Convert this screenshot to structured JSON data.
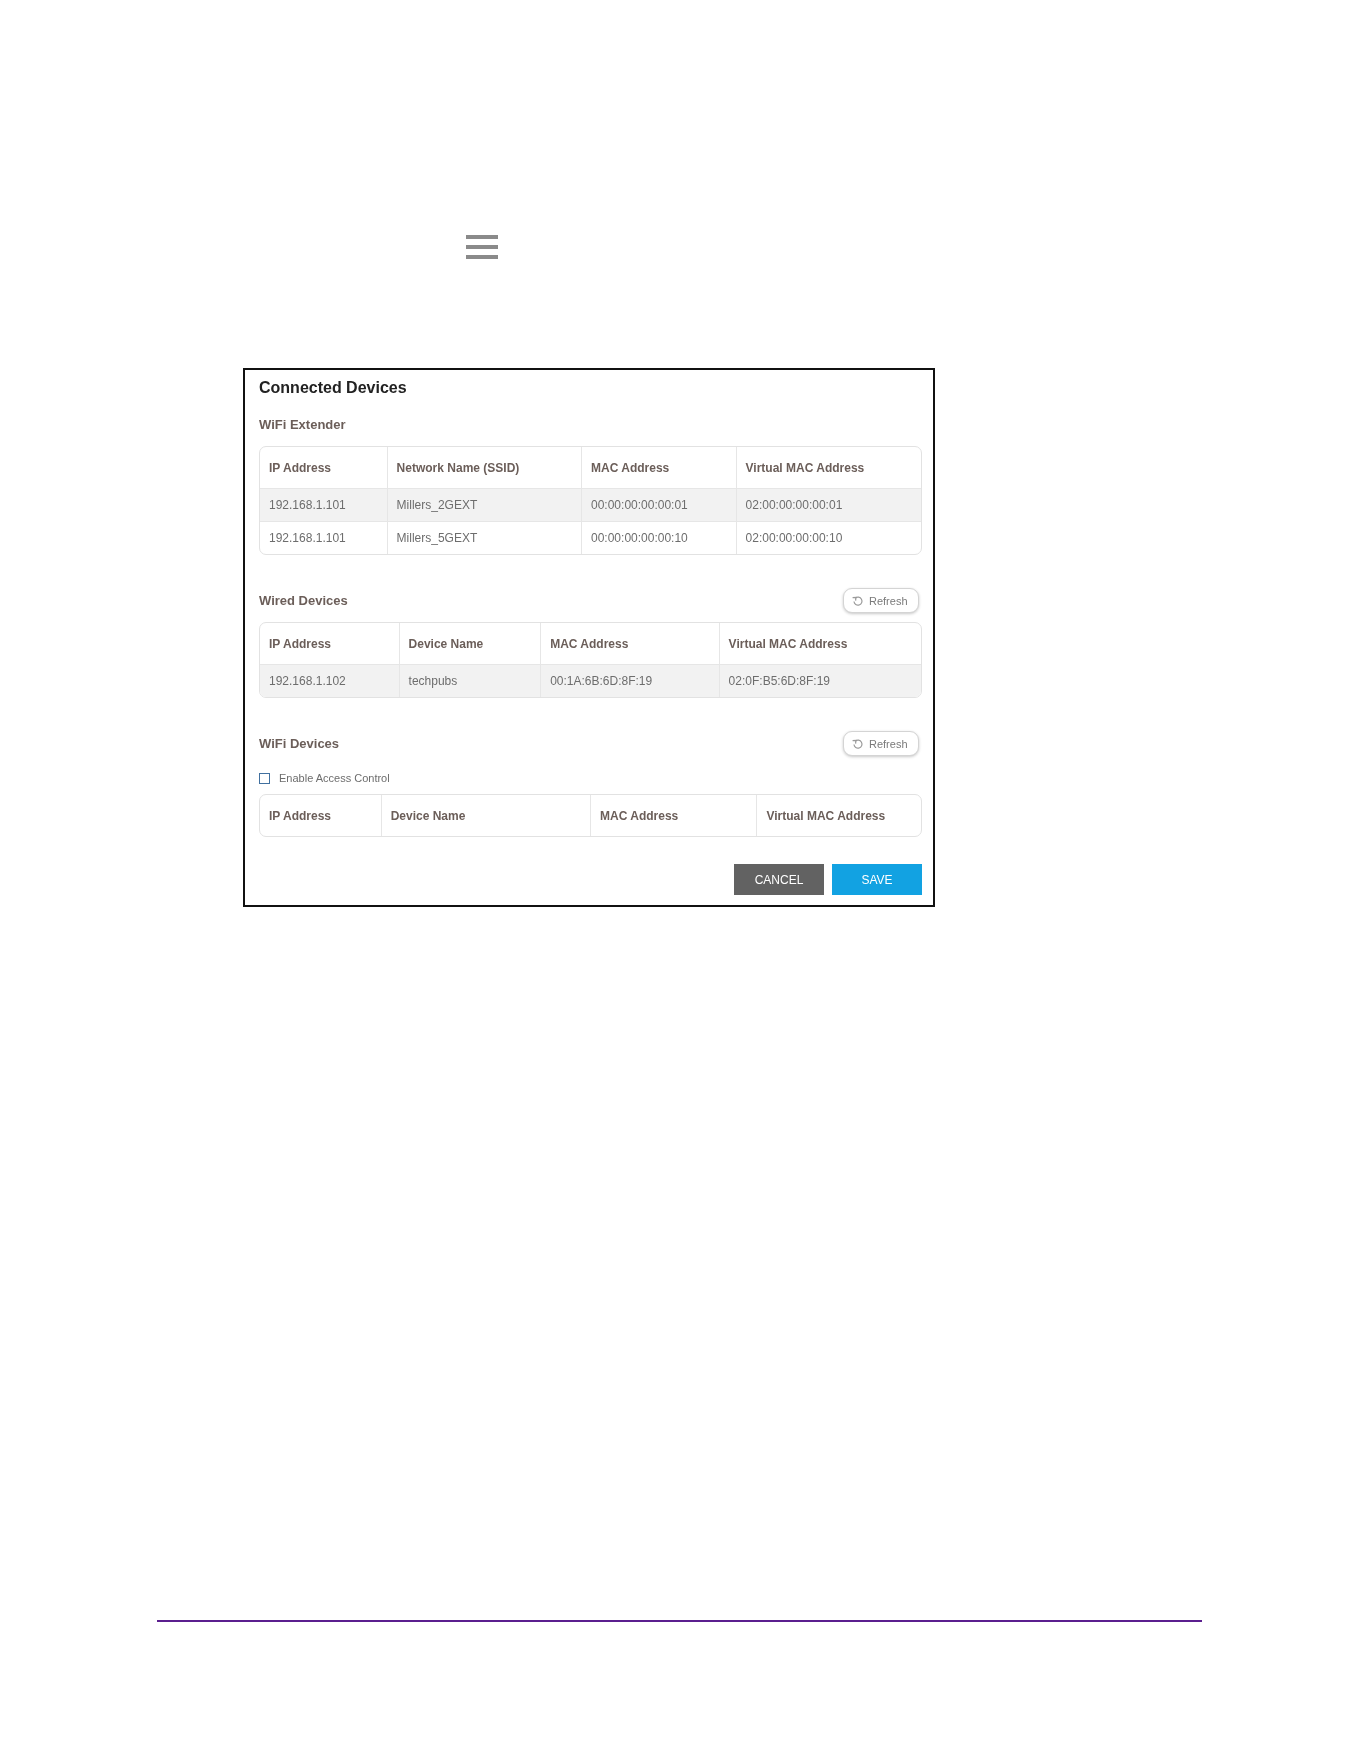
{
  "panel": {
    "title": "Connected Devices",
    "sections": [
      {
        "title": "WiFi Extender",
        "columns": [
          "IP Address",
          "Network Name (SSID)",
          "MAC Address",
          "Virtual MAC Address"
        ],
        "rows": [
          [
            "192.168.1.101",
            "Millers_2GEXT",
            "00:00:00:00:00:01",
            "02:00:00:00:00:01"
          ],
          [
            "192.168.1.101",
            "Millers_5GEXT",
            "00:00:00:00:00:10",
            "02:00:00:00:00:10"
          ]
        ]
      },
      {
        "title": "Wired Devices",
        "refresh_button": "Refresh",
        "columns": [
          "IP Address",
          "Device Name",
          "MAC Address",
          "Virtual MAC Address"
        ],
        "rows": [
          [
            "192.168.1.102",
            "techpubs",
            "00:1A:6B:6D:8F:19",
            "02:0F:B5:6D:8F:19"
          ]
        ]
      },
      {
        "title": "WiFi Devices",
        "refresh_button": "Refresh",
        "access_control": {
          "label": "Enable Access Control",
          "checked": false
        },
        "columns": [
          "IP Address",
          "Device Name",
          "MAC Address",
          "Virtual MAC Address"
        ]
      }
    ],
    "buttons": [
      {
        "label": "CANCEL",
        "kind": "secondary"
      },
      {
        "label": "SAVE",
        "kind": "primary"
      }
    ]
  }
}
